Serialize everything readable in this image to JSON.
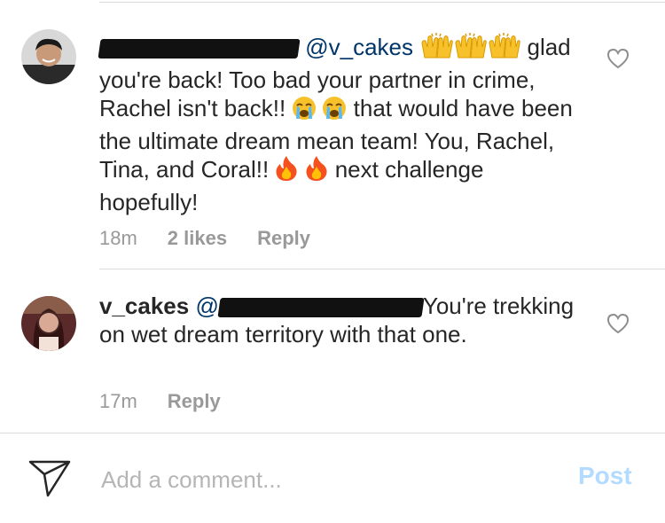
{
  "comments": [
    {
      "redacted_username": true,
      "mention": "@v_cakes",
      "leading_emoji": [
        "raised-hands-icon",
        "raised-hands-icon",
        "raised-hands-icon"
      ],
      "text_1": "glad you're back! Too bad your partner in crime, Rachel isn't back!!",
      "text_2": "that would have been the ultimate dream mean team! You, Rachel, Tina, and Coral!!",
      "text_3": "next challenge hopefully!",
      "time": "18m",
      "likes": "2 likes",
      "reply": "Reply"
    },
    {
      "username": "v_cakes",
      "mention_prefix": "@",
      "text": "You're trekking on wet dream territory with that one.",
      "time": "17m",
      "reply": "Reply"
    }
  ],
  "composer": {
    "placeholder": "Add a comment...",
    "post_label": "Post"
  },
  "colors": {
    "text": "#262626",
    "meta": "#999999",
    "mention": "#003569",
    "post_disabled": "#b3dbff",
    "divider": "#dbdbdb"
  },
  "icons": [
    "send-icon",
    "heart-outline-icon",
    "loudly-crying-face-icon",
    "fire-icon"
  ]
}
